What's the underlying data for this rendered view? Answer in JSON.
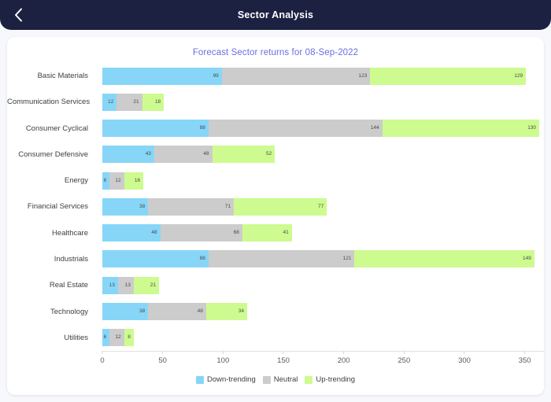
{
  "header": {
    "title": "Sector Analysis",
    "back_icon": "chevron-left-icon"
  },
  "chart_data": {
    "type": "bar",
    "orientation": "horizontal",
    "stacked": true,
    "title": "Forecast Sector returns for 08-Sep-2022",
    "xlabel": "",
    "ylabel": "",
    "xlim": [
      0,
      360
    ],
    "xticks": [
      0,
      50,
      100,
      150,
      200,
      250,
      300,
      350
    ],
    "grid": false,
    "legend_position": "bottom",
    "categories": [
      "Basic Materials",
      "Communication Services",
      "Consumer Cyclical",
      "Consumer Defensive",
      "Energy",
      "Financial Services",
      "Healthcare",
      "Industrials",
      "Real Estate",
      "Technology",
      "Utilities"
    ],
    "series": [
      {
        "name": "Down-trending",
        "color": "#87d6f8",
        "values": [
          99,
          12,
          88,
          43,
          6,
          38,
          48,
          88,
          13,
          38,
          6
        ]
      },
      {
        "name": "Neutral",
        "color": "#cccccc",
        "values": [
          123,
          21,
          144,
          48,
          12,
          71,
          68,
          121,
          13,
          48,
          12
        ]
      },
      {
        "name": "Up-trending",
        "color": "#cdfb8f",
        "values": [
          129,
          18,
          130,
          52,
          16,
          77,
          41,
          149,
          21,
          34,
          8
        ]
      }
    ]
  },
  "colors": {
    "header_bg": "#1d2141",
    "page_bg": "#f7f8fb",
    "card_bg": "#ffffff",
    "title_text": "#6a6fe0",
    "down_trending": "#87d6f8",
    "neutral": "#cccccc",
    "up_trending": "#cdfb8f"
  }
}
